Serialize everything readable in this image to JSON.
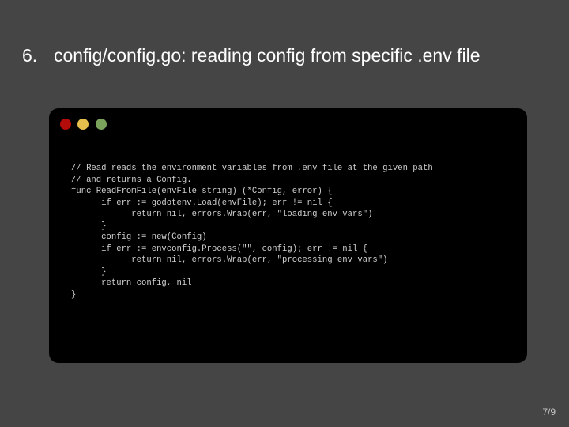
{
  "slide": {
    "number": "6.",
    "title": "config/config.go: reading config from specific .env file",
    "page": "7/9"
  },
  "window_controls": [
    {
      "name": "close",
      "color": "#b40b0b"
    },
    {
      "name": "minimize",
      "color": "#e5c04c"
    },
    {
      "name": "maximize",
      "color": "#7aa35c"
    }
  ],
  "code_lines": [
    "// Read reads the environment variables from .env file at the given path",
    "// and returns a Config.",
    "func ReadFromFile(envFile string) (*Config, error) {",
    "      if err := godotenv.Load(envFile); err != nil {",
    "            return nil, errors.Wrap(err, \"loading env vars\")",
    "      }",
    "      config := new(Config)",
    "      if err := envconfig.Process(\"\", config); err != nil {",
    "            return nil, errors.Wrap(err, \"processing env vars\")",
    "      }",
    "      return config, nil",
    "}"
  ]
}
